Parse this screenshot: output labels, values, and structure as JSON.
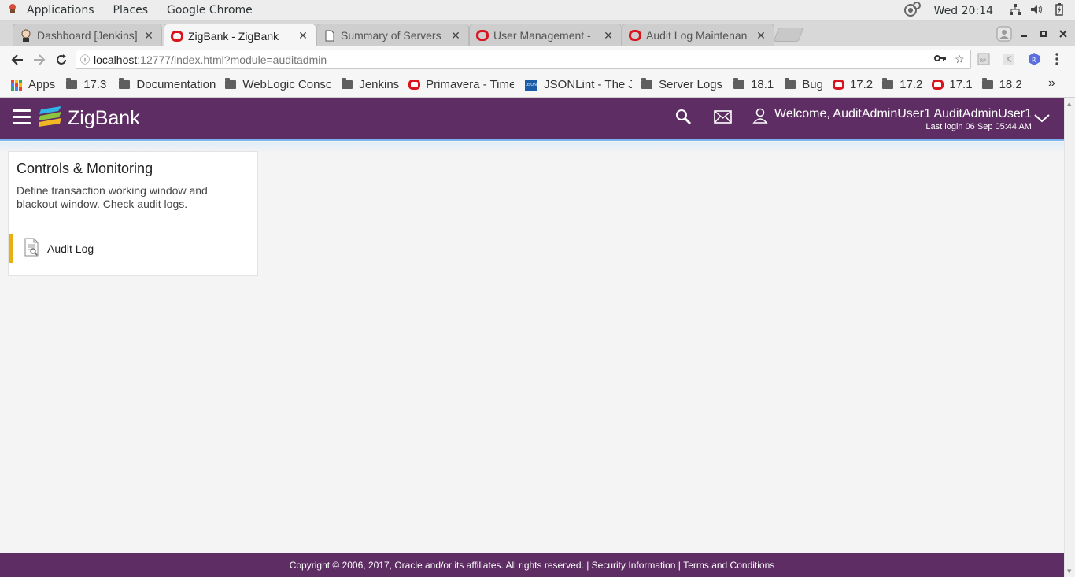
{
  "os": {
    "menu": [
      "Applications",
      "Places",
      "Google Chrome"
    ],
    "clock": "Wed 20:14"
  },
  "browser": {
    "tabs": [
      {
        "title": "Dashboard [Jenkins]",
        "icon": "jenkins-icon",
        "active": false
      },
      {
        "title": "ZigBank - ZigBank",
        "icon": "oracle-icon",
        "active": true
      },
      {
        "title": "Summary of Servers",
        "icon": "page-icon",
        "active": false
      },
      {
        "title": "User Management -",
        "icon": "oracle-icon",
        "active": false
      },
      {
        "title": "Audit Log Maintenan",
        "icon": "oracle-icon",
        "active": false
      }
    ],
    "url_host": "localhost",
    "url_path": ":12777/index.html?module=auditadmin",
    "bookmarks": [
      {
        "label": "Apps",
        "icon": "apps-grid-icon"
      },
      {
        "label": "17.3",
        "icon": "folder-icon"
      },
      {
        "label": "Documentation",
        "icon": "folder-icon"
      },
      {
        "label": "WebLogic Consol",
        "icon": "folder-icon"
      },
      {
        "label": "Jenkins",
        "icon": "folder-icon"
      },
      {
        "label": "Primavera - Time",
        "icon": "oracle-icon"
      },
      {
        "label": "JSONLint - The J",
        "icon": "json-icon"
      },
      {
        "label": "Server Logs",
        "icon": "folder-icon"
      },
      {
        "label": "18.1",
        "icon": "folder-icon"
      },
      {
        "label": "Bug",
        "icon": "folder-icon"
      },
      {
        "label": "17.2",
        "icon": "oracle-icon"
      },
      {
        "label": "17.2",
        "icon": "folder-icon"
      },
      {
        "label": "17.1",
        "icon": "oracle-icon"
      },
      {
        "label": "18.2",
        "icon": "folder-icon"
      }
    ],
    "overflow": "»"
  },
  "header": {
    "brand": "ZigBank",
    "welcome": "Welcome, AuditAdminUser1 AuditAdminUser1",
    "last_login": "Last login 06 Sep 05:44 AM",
    "colors": {
      "header": "#5e2d63",
      "accent": "#e8b00f"
    }
  },
  "card": {
    "title": "Controls & Monitoring",
    "description": "Define transaction working window and blackout window. Check audit logs.",
    "items": [
      {
        "label": "Audit Log",
        "icon": "audit-document-icon"
      }
    ]
  },
  "footer": {
    "copyright": "Copyright © 2006, 2017, Oracle and/or its affiliates. All rights reserved. |",
    "security": "Security Information",
    "sep": "|",
    "terms": "Terms and Conditions"
  }
}
